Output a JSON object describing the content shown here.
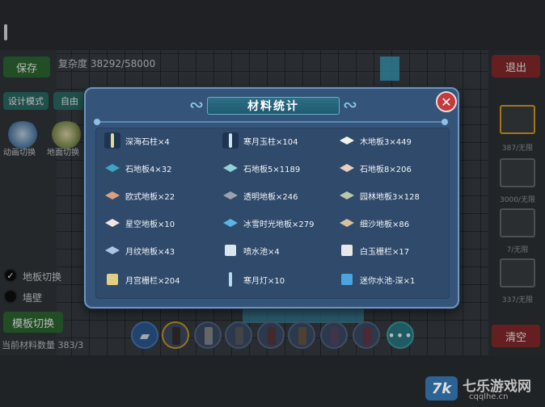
{
  "background": {
    "save_label": "保存",
    "exit_label": "退出",
    "complexity_text": "复杂度 38292/58000",
    "design_mode_label": "设计模式",
    "free_label": "自由",
    "tool_labels": [
      "动画切换",
      "地面切换"
    ],
    "options": [
      {
        "label": "地板切换",
        "checked": true
      },
      {
        "label": "墙壁",
        "checked": false
      }
    ],
    "mode_switch_label": "模板切换",
    "status_text": "当前材料数量 383/3",
    "clear_label": "清空",
    "right_counts": [
      "387/无限",
      "3000/无限",
      "7/无限",
      "337/无限"
    ]
  },
  "dialog": {
    "title": "材料统计",
    "close_icon": "close-icon",
    "items": [
      {
        "text": "深海石柱×4",
        "icon": "pillar-icon",
        "color": "#e5d79a"
      },
      {
        "text": "寒月玉柱×104",
        "icon": "pillar-icon",
        "color": "#cfe3ec"
      },
      {
        "text": "木地板3×449",
        "icon": "floor-tile-icon",
        "color": "#f4f1ea"
      },
      {
        "text": "石地板4×32",
        "icon": "floor-tile-icon",
        "color": "#3fa3c6"
      },
      {
        "text": "石地板5×1189",
        "icon": "floor-tile-icon",
        "color": "#8fd3d8"
      },
      {
        "text": "石地板8×206",
        "icon": "floor-tile-icon",
        "color": "#e9cfc0"
      },
      {
        "text": "欧式地板×22",
        "icon": "floor-tile-icon",
        "color": "#d9a183"
      },
      {
        "text": "透明地板×246",
        "icon": "floor-tile-icon",
        "color": "#9aa3ab"
      },
      {
        "text": "园林地板3×128",
        "icon": "floor-tile-icon",
        "color": "#b9c8a8"
      },
      {
        "text": "星空地板×10",
        "icon": "floor-tile-icon",
        "color": "#f0e6e4"
      },
      {
        "text": "冰雪时光地板×279",
        "icon": "floor-tile-icon",
        "color": "#58b6e6"
      },
      {
        "text": "细沙地板×86",
        "icon": "floor-tile-icon",
        "color": "#d8bfa0"
      },
      {
        "text": "月纹地板×43",
        "icon": "floor-tile-icon",
        "color": "#aec3e0"
      },
      {
        "text": "喷水池×4",
        "icon": "fountain-icon",
        "color": "#d8e6ee"
      },
      {
        "text": "白玉栅栏×17",
        "icon": "fence-icon",
        "color": "#e8e8e8"
      },
      {
        "text": "月宫栅栏×204",
        "icon": "fence-icon",
        "color": "#e2cf83"
      },
      {
        "text": "寒月灯×10",
        "icon": "lamp-icon",
        "color": "#b7d9ee"
      },
      {
        "text": "迷你水池-深×1",
        "icon": "pool-icon",
        "color": "#4aa5df"
      }
    ]
  },
  "toolbar": {
    "eraser_icon": "eraser-icon",
    "more_label": "•••",
    "slots": [
      {
        "color": "#3a3030",
        "selected": true
      },
      {
        "color": "#8b8e91",
        "selected": false
      },
      {
        "color": "#5c5f62",
        "selected": false
      },
      {
        "color": "#5a3a3d",
        "selected": false
      },
      {
        "color": "#6b5a48",
        "selected": false
      },
      {
        "color": "#5a4a6a",
        "selected": false
      },
      {
        "color": "#6a3a4a",
        "selected": false
      }
    ]
  },
  "watermark": {
    "logo_text": "7k",
    "title": "七乐游戏网",
    "url": "cqqlhe.cn"
  }
}
